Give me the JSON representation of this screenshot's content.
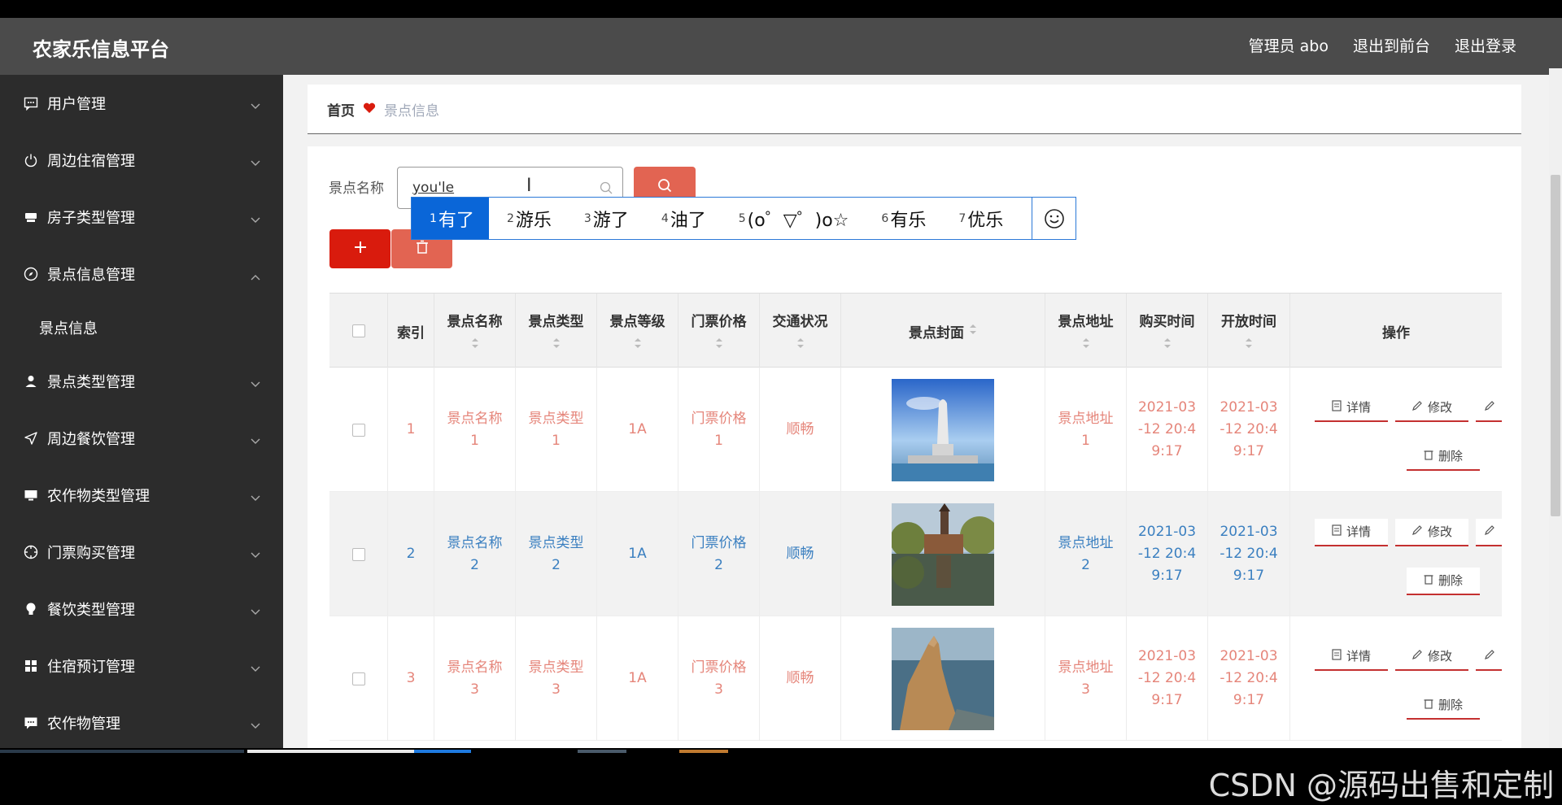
{
  "header": {
    "brand": "农家乐信息平台",
    "admin": "管理员 abo",
    "exit_front": "退出到前台",
    "logout": "退出登录"
  },
  "sidebar": {
    "items": [
      {
        "label": "用户管理",
        "icon": "message-icon"
      },
      {
        "label": "周边住宿管理",
        "icon": "power-icon"
      },
      {
        "label": "房子类型管理",
        "icon": "cup-icon"
      },
      {
        "label": "景点信息管理",
        "icon": "compass-icon",
        "expanded": true,
        "sub": "景点信息"
      },
      {
        "label": "景点类型管理",
        "icon": "user-icon"
      },
      {
        "label": "周边餐饮管理",
        "icon": "send-icon"
      },
      {
        "label": "农作物类型管理",
        "icon": "monitor-icon"
      },
      {
        "label": "门票购买管理",
        "icon": "aim-icon"
      },
      {
        "label": "餐饮类型管理",
        "icon": "bulb-icon"
      },
      {
        "label": "住宿预订管理",
        "icon": "grid-icon"
      },
      {
        "label": "农作物管理",
        "icon": "chat-icon"
      }
    ]
  },
  "breadcrumb": {
    "home": "首页",
    "current": "景点信息"
  },
  "search": {
    "label": "景点名称",
    "value": "you'le"
  },
  "ime": {
    "candidates": [
      {
        "num": "1",
        "text": "有了"
      },
      {
        "num": "2",
        "text": "游乐"
      },
      {
        "num": "3",
        "text": "游了"
      },
      {
        "num": "4",
        "text": "油了"
      },
      {
        "num": "5",
        "text": "(o゜▽゜)o☆"
      },
      {
        "num": "6",
        "text": "有乐"
      },
      {
        "num": "7",
        "text": "优乐"
      }
    ]
  },
  "table": {
    "headers": {
      "index": "索引",
      "name": "景点名称",
      "type": "景点类型",
      "level": "景点等级",
      "price": "门票价格",
      "traffic": "交通状况",
      "cover": "景点封面",
      "address": "景点地址",
      "buy_time": "购买时间",
      "open_time": "开放时间",
      "ops": "操作"
    },
    "rows": [
      {
        "index": "1",
        "name": "景点名称1",
        "type": "景点类型1",
        "level": "1A",
        "price": "门票价格1",
        "traffic": "顺畅",
        "address": "景点地址1",
        "buy_time": "2021-03-12 20:49:17",
        "open_time": "2021-03-12 20:49:17",
        "color": "red"
      },
      {
        "index": "2",
        "name": "景点名称2",
        "type": "景点类型2",
        "level": "1A",
        "price": "门票价格2",
        "traffic": "顺畅",
        "address": "景点地址2",
        "buy_time": "2021-03-12 20:49:17",
        "open_time": "2021-03-12 20:49:17",
        "color": "blue"
      },
      {
        "index": "3",
        "name": "景点名称3",
        "type": "景点类型3",
        "level": "1A",
        "price": "门票价格3",
        "traffic": "顺畅",
        "address": "景点地址3",
        "buy_time": "2021-03-12 20:49:17",
        "open_time": "2021-03-12 20:49:17",
        "color": "red"
      }
    ],
    "ops": {
      "detail": "详情",
      "edit": "修改",
      "delete": "删除"
    }
  },
  "watermark": "CSDN @源码出售和定制",
  "colors": {
    "header": "#4b4b4b",
    "sidebar": "#2c2c2c",
    "accent_red": "#d91b0d",
    "accent_soft": "#e26452",
    "ime_blue": "#0a66d8",
    "text_red": "#e5857a",
    "text_blue": "#3a7fc0"
  }
}
